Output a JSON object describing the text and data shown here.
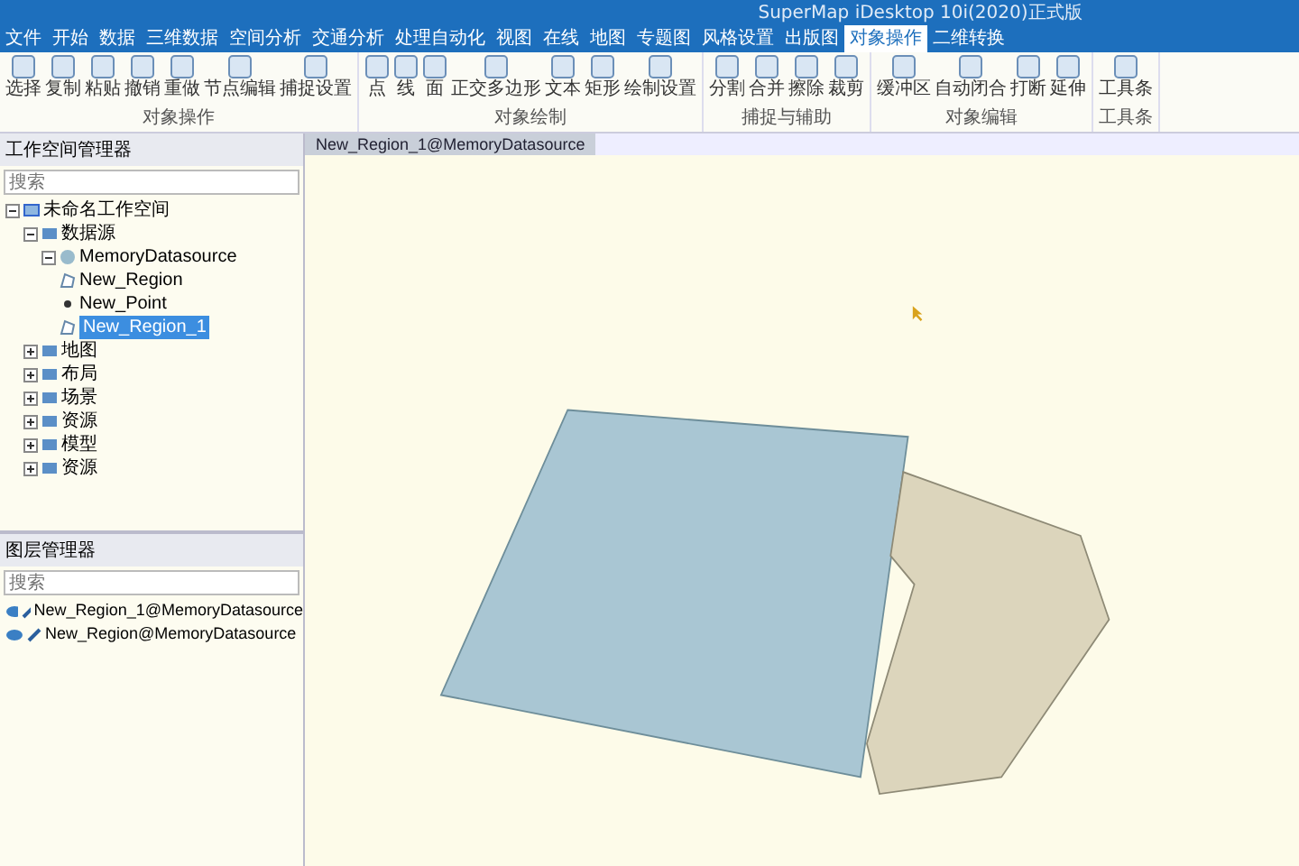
{
  "window": {
    "title": "SuperMap iDesktop 10i(2020)正式版"
  },
  "menu_tabs": [
    {
      "label": "文件",
      "selected": false
    },
    {
      "label": "开始",
      "selected": false
    },
    {
      "label": "数据",
      "selected": false
    },
    {
      "label": "三维数据",
      "selected": false
    },
    {
      "label": "空间分析",
      "selected": false
    },
    {
      "label": "交通分析",
      "selected": false
    },
    {
      "label": "处理自动化",
      "selected": false
    },
    {
      "label": "视图",
      "selected": false
    },
    {
      "label": "在线",
      "selected": false
    },
    {
      "label": "地图",
      "selected": false
    },
    {
      "label": "专题图",
      "selected": false
    },
    {
      "label": "风格设置",
      "selected": false
    },
    {
      "label": "出版图",
      "selected": false
    },
    {
      "label": "对象操作",
      "selected": true
    },
    {
      "label": "二维转换",
      "selected": false
    }
  ],
  "ribbon_groups": [
    {
      "title": "对象操作",
      "buttons": [
        "选择",
        "复制",
        "粘贴",
        "撤销",
        "重做",
        "节点编辑",
        "捕捉设置"
      ]
    },
    {
      "title": "对象绘制",
      "buttons": [
        "点",
        "线",
        "面",
        "正交多边形",
        "文本",
        "矩形",
        "绘制设置"
      ]
    },
    {
      "title": "捕捉与辅助",
      "buttons": [
        "分割",
        "合并",
        "擦除",
        "裁剪"
      ]
    },
    {
      "title": "对象编辑",
      "buttons": [
        "缓冲区",
        "自动闭合",
        "打断",
        "延伸"
      ]
    },
    {
      "title": "工具条",
      "buttons": [
        "工具条"
      ]
    }
  ],
  "workspace_panel": {
    "title": "工作空间管理器",
    "search_placeholder": "搜索",
    "tree": [
      {
        "label": "未命名工作空间",
        "kind": "workspace",
        "expanded": true,
        "selected": false,
        "children": [
          {
            "label": "数据源",
            "kind": "folder",
            "expanded": true,
            "selected": false,
            "children": [
              {
                "label": "MemoryDatasource",
                "kind": "datasource",
                "expanded": true,
                "selected": false,
                "children": [
                  {
                    "label": "New_Region",
                    "kind": "region",
                    "selected": false
                  },
                  {
                    "label": "New_Point",
                    "kind": "point",
                    "selected": false
                  },
                  {
                    "label": "New_Region_1",
                    "kind": "region",
                    "selected": true
                  }
                ]
              }
            ]
          },
          {
            "label": "地图",
            "kind": "folder",
            "expanded": false,
            "selected": false
          },
          {
            "label": "布局",
            "kind": "folder",
            "expanded": false,
            "selected": false
          },
          {
            "label": "场景",
            "kind": "folder",
            "expanded": false,
            "selected": false
          },
          {
            "label": "资源",
            "kind": "folder",
            "expanded": false,
            "selected": false
          },
          {
            "label": "模型",
            "kind": "folder",
            "expanded": false,
            "selected": false
          },
          {
            "label": "资源",
            "kind": "folder",
            "expanded": false,
            "selected": false
          }
        ]
      }
    ]
  },
  "layer_panel": {
    "title": "图层管理器",
    "search_placeholder": "搜索",
    "layers": [
      {
        "label": "New_Region_1@MemoryDatasource",
        "visible": true,
        "editable": true
      },
      {
        "label": "New_Region@MemoryDatasource",
        "visible": true,
        "editable": true
      }
    ]
  },
  "map_tab": {
    "label": "New_Region_1@MemoryDatasource"
  }
}
